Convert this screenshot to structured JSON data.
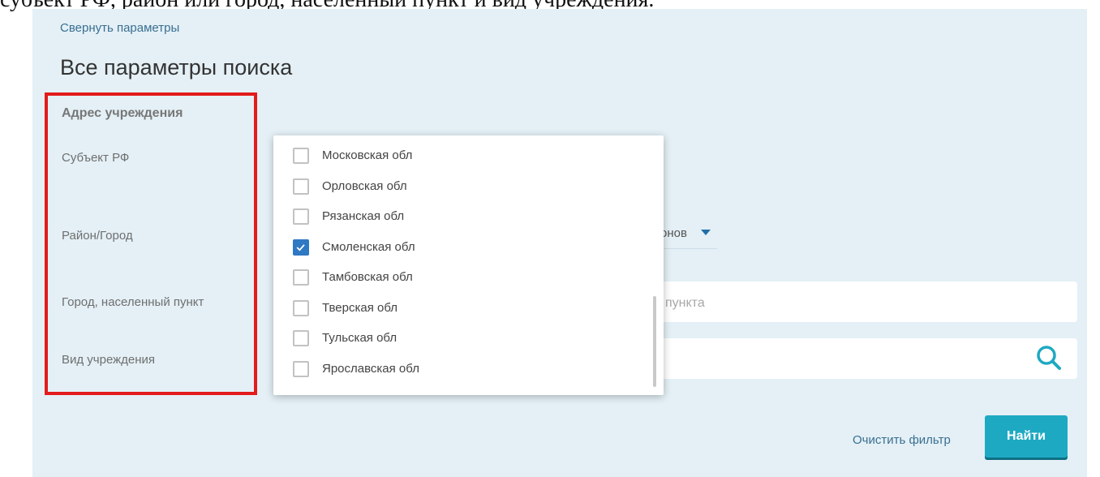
{
  "document_text": "субъект РФ, район или город, населенный пункт и вид учреждения.",
  "collapse_link": "Свернуть параметры",
  "page_title": "Все параметры поиска",
  "section_label": "Адрес учреждения",
  "fields": {
    "subject_label": "Субъект РФ",
    "district_label": "Район/Город",
    "district_value_partial": "онов",
    "city_label": "Город, населенный пункт",
    "city_placeholder_partial": "пункта",
    "type_label": "Вид учреждения"
  },
  "dropdown_options": [
    {
      "label": "Московская обл",
      "checked": false
    },
    {
      "label": "Орловская обл",
      "checked": false
    },
    {
      "label": "Рязанская обл",
      "checked": false
    },
    {
      "label": "Смоленская обл",
      "checked": true
    },
    {
      "label": "Тамбовская обл",
      "checked": false
    },
    {
      "label": "Тверская обл",
      "checked": false
    },
    {
      "label": "Тульская обл",
      "checked": false
    },
    {
      "label": "Ярославская обл",
      "checked": false
    }
  ],
  "actions": {
    "clear_label": "Очистить фильтр",
    "find_label": "Найти"
  },
  "icons": {
    "search": "search-icon",
    "caret": "caret-down-icon",
    "check": "check-icon"
  },
  "colors": {
    "panel_bg": "#e4f0f6",
    "accent": "#1ea9c2",
    "checkbox_checked": "#2f78c4",
    "highlight_border": "#e31b1b",
    "link": "#3a6f91"
  }
}
